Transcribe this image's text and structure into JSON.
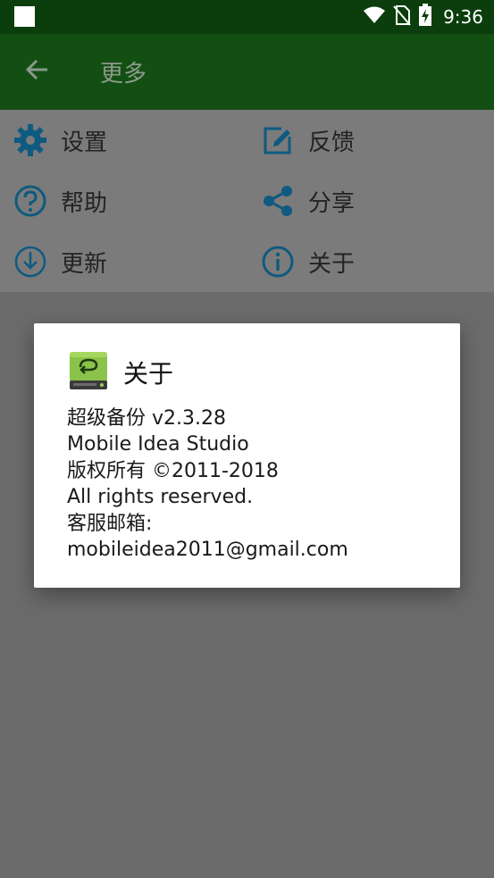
{
  "status_bar": {
    "time": "9:36",
    "icons": [
      "wifi-icon",
      "no-sim-icon",
      "battery-charging-icon"
    ]
  },
  "app_bar": {
    "title": "更多",
    "back_icon": "arrow-left-icon"
  },
  "menu": {
    "items": [
      {
        "label": "设置",
        "icon": "gear-icon"
      },
      {
        "label": "反馈",
        "icon": "edit-icon"
      },
      {
        "label": "帮助",
        "icon": "help-circle-icon"
      },
      {
        "label": "分享",
        "icon": "share-icon"
      },
      {
        "label": "更新",
        "icon": "download-circle-icon"
      },
      {
        "label": "关于",
        "icon": "info-circle-icon"
      }
    ],
    "icon_color": "#0f5a80"
  },
  "dialog": {
    "title": "关于",
    "icon": "app-logo-icon",
    "lines": [
      "超级备份 v2.3.28",
      "Mobile Idea Studio",
      "版权所有 ©2011-2018",
      "All rights reserved.",
      "客服邮箱:",
      "mobileidea2011@gmail.com"
    ]
  },
  "colors": {
    "status_bar": "#0c3d0c",
    "app_bar": "#134f13",
    "scrim": "#6b6b6b",
    "accent": "#0f5a80",
    "logo_green": "#8bc34a"
  }
}
